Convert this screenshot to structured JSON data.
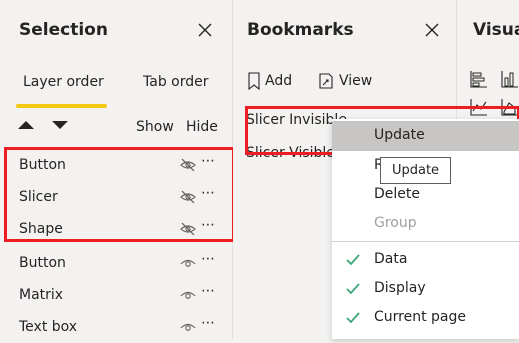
{
  "selection": {
    "title": "Selection",
    "tabs": [
      {
        "label": "Layer order",
        "active": true
      },
      {
        "label": "Tab order",
        "active": false
      }
    ],
    "columns": {
      "show": "Show",
      "hide": "Hide"
    },
    "layers": [
      {
        "label": "Button",
        "hidden": true
      },
      {
        "label": "Slicer",
        "hidden": true
      },
      {
        "label": "Shape",
        "hidden": true
      },
      {
        "label": "Button",
        "hidden": false
      },
      {
        "label": "Matrix",
        "hidden": false
      },
      {
        "label": "Text box",
        "hidden": false
      }
    ],
    "more_glyph": "⋯"
  },
  "bookmarks": {
    "title": "Bookmarks",
    "add_label": "Add",
    "view_label": "View",
    "items": [
      "Slicer Invisible",
      "Slicer Visible"
    ]
  },
  "visuals": {
    "title": "Visua"
  },
  "context_menu": {
    "items": [
      {
        "label": "Update",
        "highlighted": true
      },
      {
        "label": "R",
        "partial": true
      },
      {
        "label": "Delete"
      },
      {
        "label": "Group",
        "disabled": true
      }
    ],
    "checked_items": [
      {
        "label": "Data",
        "checked": true
      },
      {
        "label": "Display",
        "checked": true
      },
      {
        "label": "Current page",
        "checked": true
      }
    ]
  },
  "tooltip": {
    "text": "Update"
  },
  "colors": {
    "highlight_border": "#ee1c23",
    "active_tab_underline": "#f2c811",
    "check": "#3aa575",
    "menu_hover": "#c8c6c4",
    "pane_bg": "#f3f2f1"
  }
}
